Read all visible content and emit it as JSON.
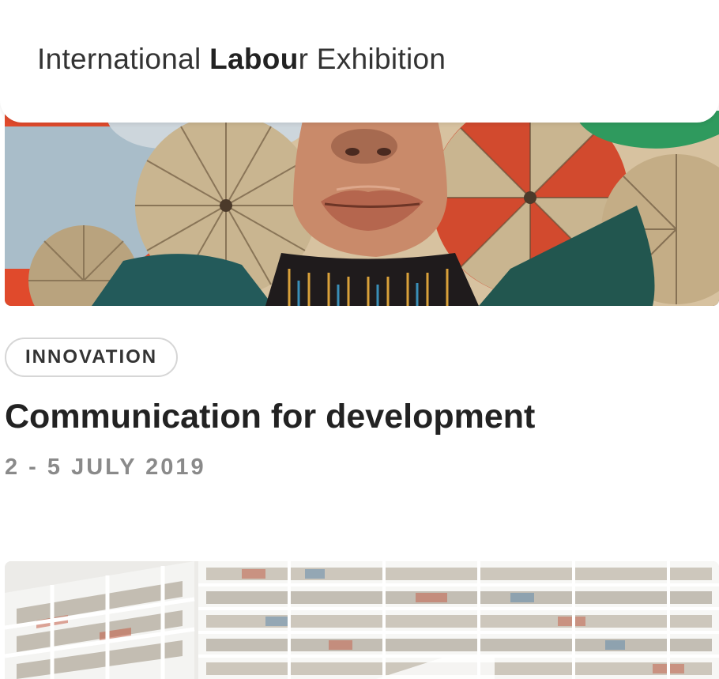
{
  "header": {
    "brand_prefix": "International ",
    "brand_bold": "Labou",
    "brand_suffix": "r Exhibition"
  },
  "events": [
    {
      "image": "painted mural of face with paper fans",
      "tag": "INNOVATION",
      "title": "Communication for development",
      "date": "2 - 5 JULY 2019"
    },
    {
      "image": "library with white bookshelves"
    }
  ]
}
